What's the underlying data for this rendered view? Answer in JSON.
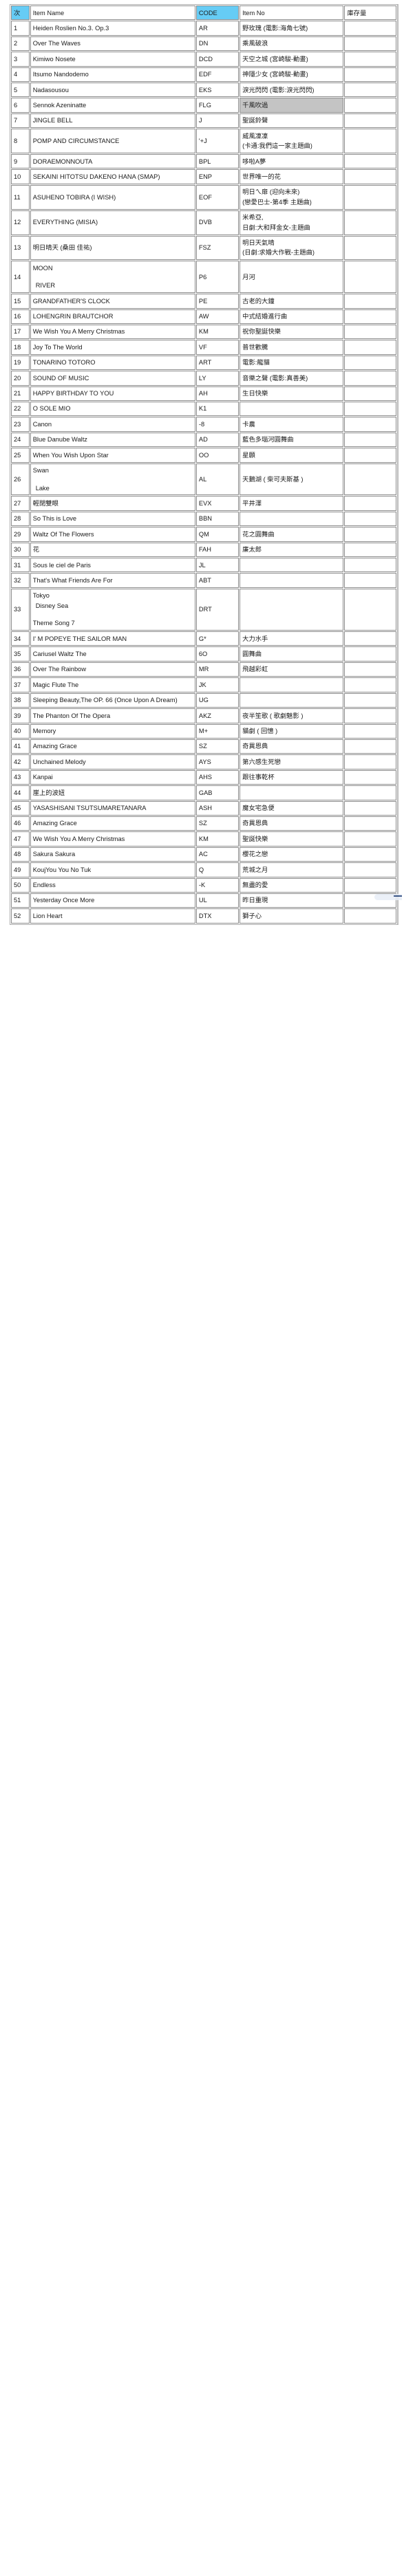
{
  "document": {
    "type": "inventory-table",
    "accent_color": "#66ccf5",
    "highlight_color": "#c4c4c4",
    "border_color": "#8c8c8c",
    "row_count": 52
  },
  "table": {
    "headers": {
      "seq": "次",
      "name": "Item Name",
      "code": "CODE",
      "item_no": "Item No",
      "qty": "庫存量"
    },
    "rows": [
      {
        "seq": "1",
        "name": "Heiden Roslien No.3. Op.3",
        "code": "AR",
        "item_no": "野玫瑰 (電影:海角七號)",
        "qty": ""
      },
      {
        "seq": "2",
        "name": "Over The Waves",
        "code": "DN",
        "item_no": "乘風破浪",
        "qty": ""
      },
      {
        "seq": "3",
        "name": "Kimiwo Nosete",
        "code": "DCD",
        "item_no": "天空之城 (宮崎駿-動畫)",
        "qty": ""
      },
      {
        "seq": "4",
        "name": "Itsumo Nandodemo",
        "code": "EDF",
        "item_no": "神隱少女 (宮崎駿-動畫)",
        "qty": ""
      },
      {
        "seq": "5",
        "name": "Nadasousou",
        "code": "EKS",
        "item_no": "淚光閃閃 (電影:淚光閃閃)",
        "qty": ""
      },
      {
        "seq": "6",
        "name": "Sennok Azeninatte",
        "code": "FLG",
        "item_no": "千風吹過",
        "qty": "",
        "highlight": true
      },
      {
        "seq": "7",
        "name": "JINGLE BELL",
        "code": "J",
        "item_no": "聖誕鈴聲",
        "qty": ""
      },
      {
        "seq": "8",
        "name": "POMP AND CIRCUMSTANCE",
        "code": "'+J",
        "item_no": "威風凜凜\n(卡通:我們這一家主題曲)",
        "qty": ""
      },
      {
        "seq": "9",
        "name": "DORAEMONNOUTA",
        "code": "BPL",
        "item_no": "哆啦A夢",
        "qty": ""
      },
      {
        "seq": "10",
        "name": "SEKAINI HITOTSU DAKENO HANA (SMAP)",
        "code": "ENP",
        "item_no": "世界唯一的花",
        "qty": ""
      },
      {
        "seq": "11",
        "name": "ASUHENO TOBIRA (I WISH)",
        "code": "EOF",
        "item_no": "明日ㄟ扉 (迎向未來)\n(戀愛巴士-第4季 主題曲)",
        "qty": ""
      },
      {
        "seq": "12",
        "name": "EVERYTHING (MISIA)",
        "code": "DVB",
        "item_no": "米希亞,\n日劇:大和拜金女-主題曲",
        "qty": ""
      },
      {
        "seq": "13",
        "name": "明日晴天 (桑田 佳祐)",
        "code": "FSZ",
        "item_no": "明日天氣晴\n(日劇:求婚大作戰-主題曲)",
        "qty": ""
      },
      {
        "seq": "14",
        "name": "MOON\n\n RIVER",
        "code": "P6",
        "item_no": "月河",
        "qty": ""
      },
      {
        "seq": "15",
        "name": "GRANDFATHER'S CLOCK",
        "code": "PE",
        "item_no": "古老的大鐘",
        "qty": ""
      },
      {
        "seq": "16",
        "name": "LOHENGRIN BRAUTCHOR",
        "code": "AW",
        "item_no": "中式結婚進行曲",
        "qty": ""
      },
      {
        "seq": "17",
        "name": "We Wish You A Merry Christmas",
        "code": "KM",
        "item_no": "祝你聖誕快樂",
        "qty": ""
      },
      {
        "seq": "18",
        "name": "Joy To The World",
        "code": "VF",
        "item_no": "普世歡騰",
        "qty": ""
      },
      {
        "seq": "19",
        "name": "TONARINO TOTORO",
        "code": "ART",
        "item_no": "電影:龍貓",
        "qty": ""
      },
      {
        "seq": "20",
        "name": "SOUND OF MUSIC",
        "code": "LY",
        "item_no": "音樂之聲 (電影:真善美)",
        "qty": ""
      },
      {
        "seq": "21",
        "name": "HAPPY BIRTHDAY TO YOU",
        "code": "AH",
        "item_no": "生日快樂",
        "qty": ""
      },
      {
        "seq": "22",
        "name": "O SOLE MIO",
        "code": "K1",
        "item_no": "",
        "qty": ""
      },
      {
        "seq": "23",
        "name": "Canon",
        "code": "-8",
        "item_no": "卡農",
        "qty": ""
      },
      {
        "seq": "24",
        "name": "Blue Danube Waltz",
        "code": "AD",
        "item_no": "藍色多瑙河圓舞曲",
        "qty": ""
      },
      {
        "seq": "25",
        "name": "When You Wish Upon Star",
        "code": "OO",
        "item_no": "星願",
        "qty": ""
      },
      {
        "seq": "26",
        "name": "Swan\n\n Lake",
        "code": "AL",
        "item_no": "天鵝湖 ( 柴可夫斯基 )",
        "qty": ""
      },
      {
        "seq": "27",
        "name": "輕閉雙眼",
        "code": "EVX",
        "item_no": "平井澤",
        "qty": ""
      },
      {
        "seq": "28",
        "name": "So This is Love",
        "code": "BBN",
        "item_no": "",
        "qty": ""
      },
      {
        "seq": "29",
        "name": "Waltz Of The Flowers",
        "code": "QM",
        "item_no": "花之圓舞曲",
        "qty": ""
      },
      {
        "seq": "30",
        "name": "花",
        "code": "FAH",
        "item_no": "廉太郎",
        "qty": ""
      },
      {
        "seq": "31",
        "name": "Sous le ciel de Paris",
        "code": "JL",
        "item_no": "",
        "qty": ""
      },
      {
        "seq": "32",
        "name": "That's What Friends Are For",
        "code": "ABT",
        "item_no": "",
        "qty": ""
      },
      {
        "seq": "33",
        "name": "Tokyo\n Disney Sea\n\nTheme Song 7",
        "code": "DRT",
        "item_no": "",
        "qty": ""
      },
      {
        "seq": "34",
        "name": "I' M POPEYE THE SAILOR MAN",
        "code": "G*",
        "item_no": "大力水手",
        "qty": ""
      },
      {
        "seq": "35",
        "name": "Cariusel Waltz The",
        "code": "6O",
        "item_no": "圓舞曲",
        "qty": ""
      },
      {
        "seq": "36",
        "name": "Over The Rainbow",
        "code": "MR",
        "item_no": "飛越彩虹",
        "qty": ""
      },
      {
        "seq": "37",
        "name": "Magic   Flute   The",
        "code": "JK",
        "item_no": "",
        "qty": ""
      },
      {
        "seq": "38",
        "name": "Sleeping Beauty,The OP. 66 (Once Upon A Dream)",
        "code": "UG",
        "item_no": "",
        "qty": ""
      },
      {
        "seq": "39",
        "name": "The Phanton Of The Opera",
        "code": "AKZ",
        "item_no": "夜半笙歌 ( 歌劇魅影 )",
        "qty": ""
      },
      {
        "seq": "40",
        "name": "Memory",
        "code": "M+",
        "item_no": "貓劇 ( 回憶 )",
        "qty": ""
      },
      {
        "seq": "41",
        "name": "Amazing Grace",
        "code": "SZ",
        "item_no": "奇異恩典",
        "qty": ""
      },
      {
        "seq": "42",
        "name": "Unchained Melody",
        "code": "AYS",
        "item_no": "第六感生死戀",
        "qty": ""
      },
      {
        "seq": "43",
        "name": "Kanpai",
        "code": "AHS",
        "item_no": "跟往事乾杯",
        "qty": ""
      },
      {
        "seq": "44",
        "name": "崖上的波妞",
        "code": "GAB",
        "item_no": "",
        "qty": ""
      },
      {
        "seq": "45",
        "name": "YASASHISANI TSUTSUMARETANARA",
        "code": "ASH",
        "item_no": "魔女宅急便",
        "qty": ""
      },
      {
        "seq": "46",
        "name": "Amazing Grace",
        "code": "SZ",
        "item_no": "奇異恩典",
        "qty": ""
      },
      {
        "seq": "47",
        "name": "We Wish You A Merry Christmas",
        "code": "KM",
        "item_no": "聖誕快樂",
        "qty": ""
      },
      {
        "seq": "48",
        "name": "Sakura  Sakura",
        "code": "AC",
        "item_no": "櫻花之戀",
        "qty": ""
      },
      {
        "seq": "49",
        "name": "KoujYou You No Tuk",
        "code": "Q",
        "item_no": "荒城之月",
        "qty": ""
      },
      {
        "seq": "50",
        "name": "Endless",
        "code": "-K",
        "item_no": "無盡的愛",
        "qty": ""
      },
      {
        "seq": "51",
        "name": "Yesterday Once More",
        "code": "UL",
        "item_no": "昨日重現",
        "qty": ""
      },
      {
        "seq": "52",
        "name": "Lion Heart",
        "code": "DTX",
        "item_no": "獅子心",
        "qty": ""
      }
    ]
  }
}
